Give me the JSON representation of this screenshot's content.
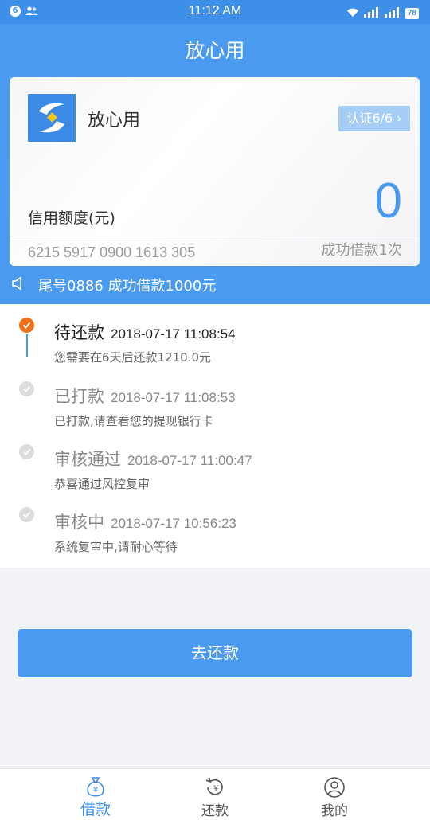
{
  "status_bar": {
    "notification_count": "6",
    "time": "11:12 AM",
    "battery": "78"
  },
  "header": {
    "title": "放心用"
  },
  "card": {
    "name": "放心用",
    "cert_label": "认证6/6",
    "credit_label": "信用额度(元)",
    "credit_amount": "0",
    "card_number": "6215 5917 0900 1613 305",
    "success_count": "成功借款1次"
  },
  "notice": {
    "text": "尾号0886 成功借款1000元"
  },
  "timeline": [
    {
      "title": "待还款",
      "time": "2018-07-17 11:08:54",
      "desc": "您需要在6天后还款1210.0元",
      "state": "active"
    },
    {
      "title": "已打款",
      "time": "2018-07-17 11:08:53",
      "desc": "已打款,请查看您的提现银行卡",
      "state": "done"
    },
    {
      "title": "审核通过",
      "time": "2018-07-17 11:00:47",
      "desc": "恭喜通过风控复审",
      "state": "done"
    },
    {
      "title": "审核中",
      "time": "2018-07-17 10:56:23",
      "desc": "系统复审中,请耐心等待",
      "state": "done"
    }
  ],
  "actions": {
    "repay_label": "去还款"
  },
  "tabs": [
    {
      "label": "借款",
      "icon": "money-bag-icon",
      "active": true
    },
    {
      "label": "还款",
      "icon": "repay-icon",
      "active": false
    },
    {
      "label": "我的",
      "icon": "profile-icon",
      "active": false
    }
  ],
  "colors": {
    "primary": "#4a9af0",
    "active_dot": "#f0701a",
    "cert_button": "#a5cdf6"
  }
}
